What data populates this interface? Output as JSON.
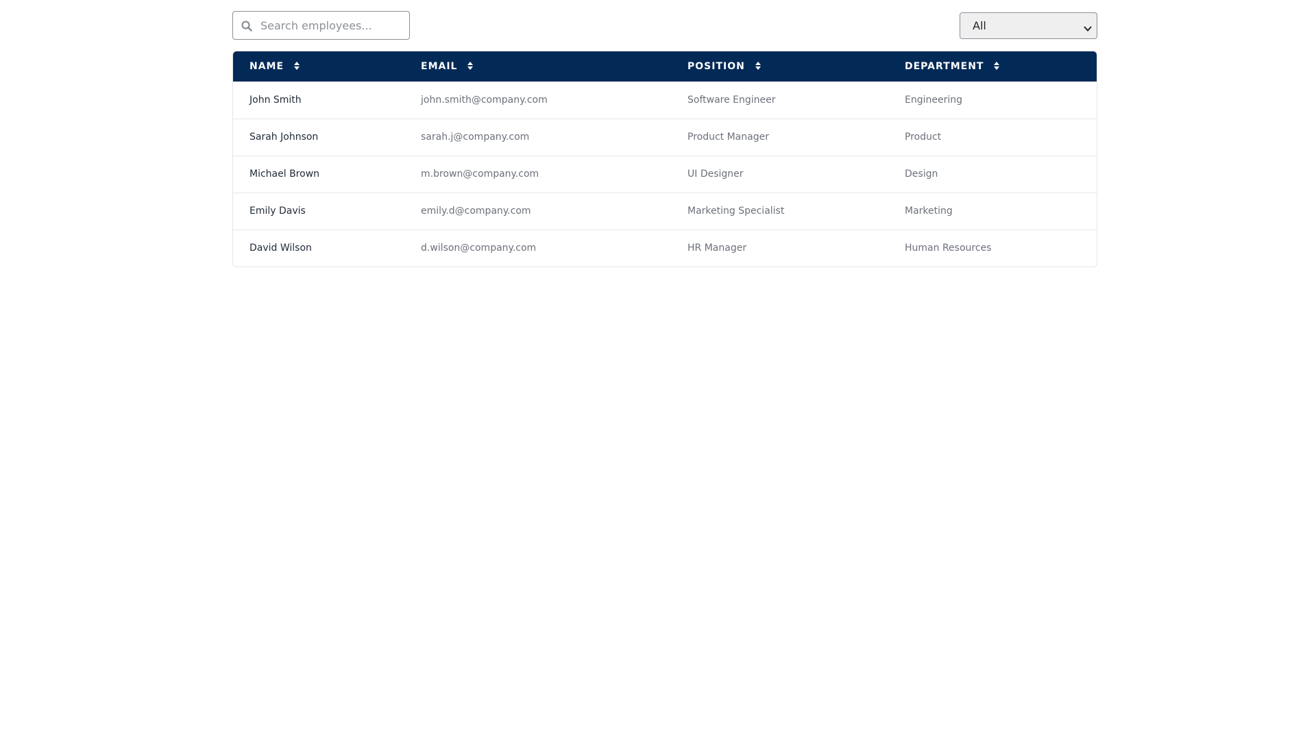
{
  "search": {
    "placeholder": "Search employees...",
    "value": "",
    "icon": "search-icon"
  },
  "filter": {
    "selected": "All",
    "options": [
      "All"
    ]
  },
  "colors": {
    "header_bg": "#032a57",
    "header_text": "#ffffff",
    "border": "#e3e6ea"
  },
  "table": {
    "columns": [
      {
        "label": "NAME",
        "sort_icon": "sort-icon"
      },
      {
        "label": "EMAIL",
        "sort_icon": "sort-icon"
      },
      {
        "label": "POSITION",
        "sort_icon": "sort-icon"
      },
      {
        "label": "DEPARTMENT",
        "sort_icon": "sort-icon"
      }
    ],
    "rows": [
      {
        "name": "John Smith",
        "email": "john.smith@company.com",
        "position": "Software Engineer",
        "department": "Engineering"
      },
      {
        "name": "Sarah Johnson",
        "email": "sarah.j@company.com",
        "position": "Product Manager",
        "department": "Product"
      },
      {
        "name": "Michael Brown",
        "email": "m.brown@company.com",
        "position": "UI Designer",
        "department": "Design"
      },
      {
        "name": "Emily Davis",
        "email": "emily.d@company.com",
        "position": "Marketing Specialist",
        "department": "Marketing"
      },
      {
        "name": "David Wilson",
        "email": "d.wilson@company.com",
        "position": "HR Manager",
        "department": "Human Resources"
      }
    ]
  }
}
